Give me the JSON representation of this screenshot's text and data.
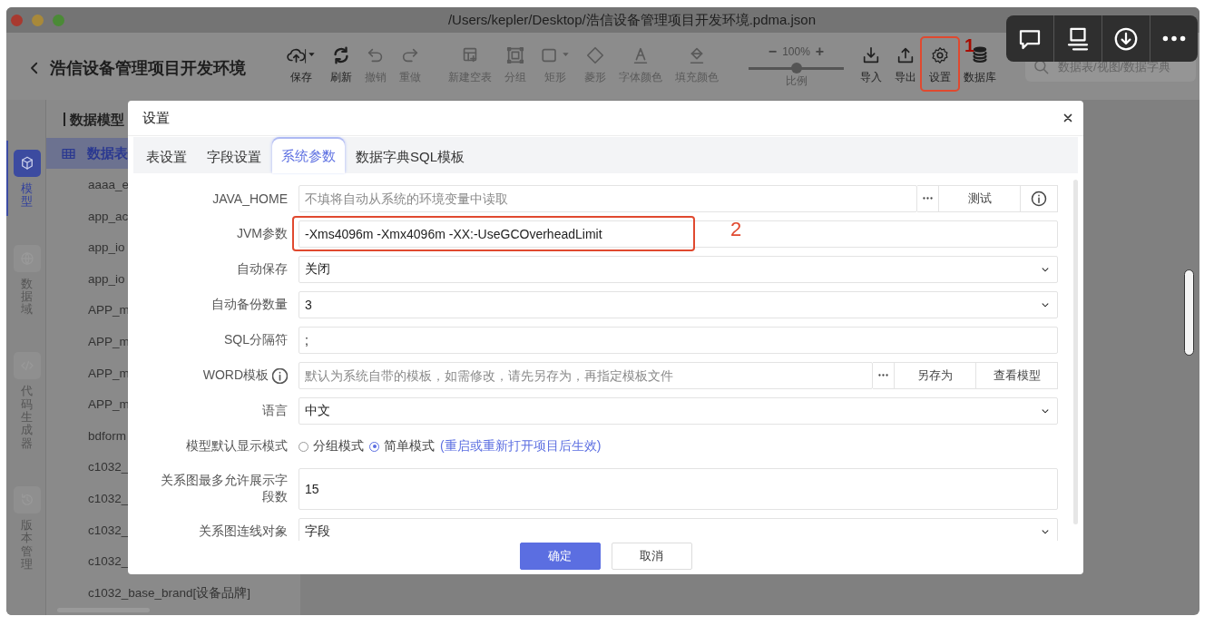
{
  "window": {
    "title": "/Users/kepler/Desktop/浩信设备管理项目开发环境.pdma.json"
  },
  "toolbar": {
    "project": "浩信设备管理项目开发环境",
    "tools": [
      {
        "label": "保存",
        "disabled": false
      },
      {
        "label": "刷新",
        "disabled": false
      },
      {
        "label": "撤销",
        "disabled": true
      },
      {
        "label": "重做",
        "disabled": true
      },
      {
        "label": "新建空表",
        "disabled": true
      },
      {
        "label": "分组",
        "disabled": true
      },
      {
        "label": "矩形",
        "disabled": true
      },
      {
        "label": "菱形",
        "disabled": true
      },
      {
        "label": "字体颜色",
        "disabled": true
      },
      {
        "label": "填充颜色",
        "disabled": true
      }
    ],
    "zoom": {
      "zoom_out": "−",
      "value": "100%",
      "zoom_in": "+",
      "label": "比例",
      "level": 0.5
    },
    "actions": [
      {
        "label": "导入"
      },
      {
        "label": "导出"
      },
      {
        "label": "设置",
        "annotation": "1"
      },
      {
        "label": "数据库"
      }
    ],
    "search": {
      "placeholder": "数据表/视图/数据字典"
    }
  },
  "rail": [
    {
      "label": "模型",
      "selected": true
    },
    {
      "label": "数据域",
      "selected": false
    },
    {
      "label": "代码生成器",
      "selected": false
    },
    {
      "label": "版本管理",
      "selected": false
    }
  ],
  "tree": {
    "title": "数据模型",
    "group": {
      "label": "数据表",
      "selected": true,
      "children": [
        {
          "label": "aaaa_e",
          "selected": false
        },
        {
          "label": "app_ac",
          "selected": false
        },
        {
          "label": "app_io",
          "selected": false
        },
        {
          "label": "app_io",
          "selected": false
        },
        {
          "label": "APP_m",
          "selected": false
        },
        {
          "label": "APP_m",
          "selected": false
        },
        {
          "label": "APP_m",
          "selected": false
        },
        {
          "label": "APP_m",
          "selected": false
        },
        {
          "label": "bdform",
          "selected": false
        },
        {
          "label": "c1032_",
          "selected": false
        },
        {
          "label": "c1032_",
          "selected": false
        },
        {
          "label": "c1032_",
          "selected": false
        },
        {
          "label": "c1032_",
          "selected": false
        },
        {
          "label": "c1032_base_brand[设备品牌]",
          "selected": false
        }
      ]
    }
  },
  "dialog": {
    "title": "设置",
    "tabs": [
      {
        "label": "表设置",
        "selected": false
      },
      {
        "label": "字段设置",
        "selected": false
      },
      {
        "label": "系统参数",
        "selected": true
      },
      {
        "label": "数据字典SQL模板",
        "selected": false
      }
    ],
    "fields": [
      {
        "label": "JAVA_HOME",
        "kind": "input",
        "placeholder": "不填将自动从系统的环境变量中读取",
        "buttons": [
          {
            "kind": "more"
          },
          {
            "kind": "text",
            "label": "测试"
          },
          {
            "kind": "info"
          }
        ]
      },
      {
        "label": "JVM参数",
        "kind": "input",
        "value": "-Xms4096m -Xmx4096m -XX:-UseGCOverheadLimit",
        "annotation": "2"
      },
      {
        "label": "自动保存",
        "kind": "select",
        "value": "关闭"
      },
      {
        "label": "自动备份数量",
        "kind": "select",
        "value": "3"
      },
      {
        "label": "SQL分隔符",
        "kind": "input",
        "value": ";"
      },
      {
        "label": "WORD模板",
        "label_info": true,
        "kind": "input",
        "placeholder": "默认为系统自带的模板，如需修改，请先另存为，再指定模板文件",
        "buttons": [
          {
            "kind": "more"
          },
          {
            "kind": "text",
            "label": "另存为"
          },
          {
            "kind": "text",
            "label": "查看模型"
          }
        ]
      },
      {
        "label": "语言",
        "kind": "select",
        "value": "中文"
      },
      {
        "label": "模型默认显示模式",
        "kind": "radio",
        "options": [
          {
            "label": "分组模式",
            "selected": false
          },
          {
            "label": "简单模式",
            "selected": true
          }
        ],
        "note": "(重启或重新打开项目后生效)"
      },
      {
        "label": "关系图最多允许展示字段数",
        "kind": "multiline",
        "value": "15"
      },
      {
        "label": "关系图连线对象",
        "kind": "select",
        "value": "字段"
      }
    ],
    "buttons": [
      {
        "label": "确定",
        "primary": true
      },
      {
        "label": "取消",
        "primary": false
      }
    ]
  }
}
